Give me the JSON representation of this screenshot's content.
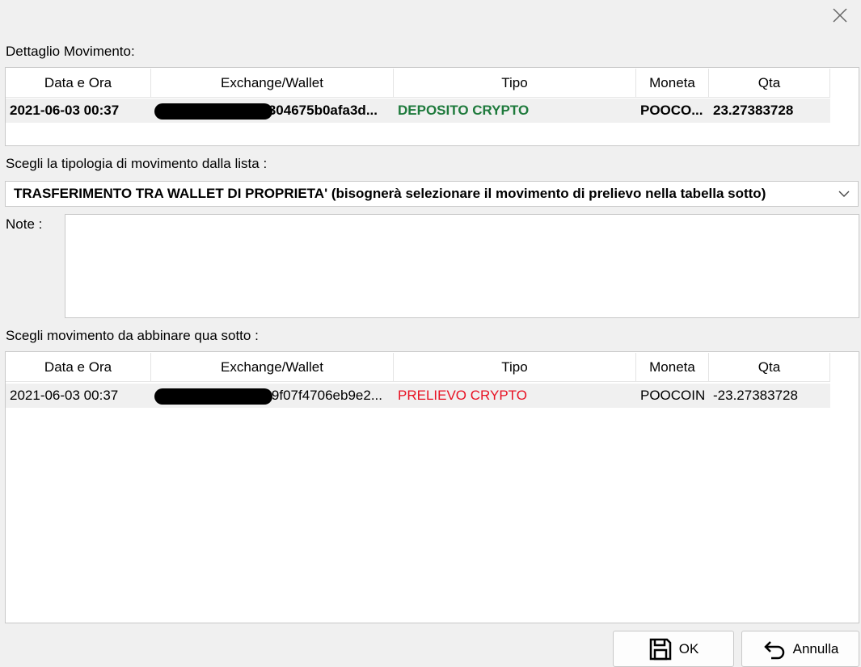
{
  "close_icon": "close-icon",
  "labels": {
    "detail": "Dettaglio Movimento:",
    "choose_type": "Scegli la tipologia di movimento dalla lista :",
    "note": "Note :",
    "choose_match": "Scegli movimento da abbinare qua sotto :"
  },
  "columns": [
    "Data e Ora",
    "Exchange/Wallet",
    "Tipo",
    "Moneta",
    "Qta"
  ],
  "detail_row": {
    "datetime": "2021-06-03 00:37",
    "wallet": "304675b0afa3d...",
    "tipo": "DEPOSITO CRYPTO",
    "moneta": "POOCO...",
    "qta": "23.27383728"
  },
  "type_select": {
    "value": "TRASFERIMENTO TRA WALLET DI PROPRIETA' (bisognerà selezionare il movimento di prelievo nella tabella sotto)"
  },
  "notes": {
    "value": ""
  },
  "match_row": {
    "datetime": "2021-06-03 00:37",
    "wallet": "9f07f4706eb9e2...",
    "tipo": "PRELIEVO CRYPTO",
    "moneta": "POOCOIN",
    "qta": "-23.27383728"
  },
  "buttons": {
    "ok": "OK",
    "cancel": "Annulla"
  },
  "colors": {
    "deposit": "#1e7a3c",
    "withdraw": "#e81123"
  }
}
